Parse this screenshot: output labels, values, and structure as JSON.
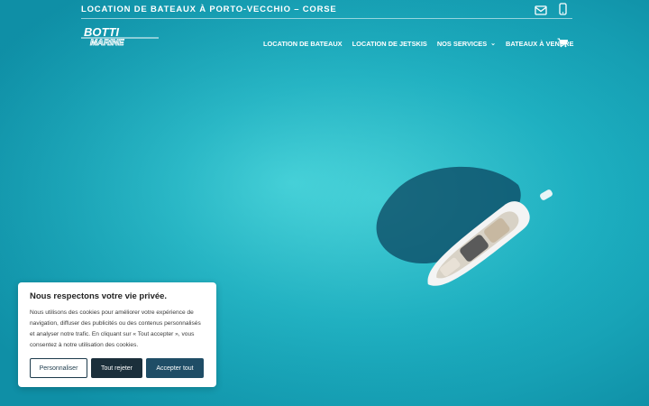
{
  "header": {
    "tagline": "LOCATION DE BATEAUX À PORTO-VECCHIO – CORSE",
    "icons": [
      "mail-icon",
      "phone-icon"
    ],
    "logo_text": "BOTTI MARINE"
  },
  "nav": {
    "items": [
      {
        "label": "LOCATION DE BATEAUX"
      },
      {
        "label": "LOCATION DE JETSKIS"
      },
      {
        "label": "NOS SERVICES"
      },
      {
        "label": "BATEAUX À VENDRE"
      }
    ],
    "cart_icon": "cart-icon"
  },
  "cookie_banner": {
    "title": "Nous respectons votre vie privée.",
    "text": "Nous utilisons des cookies pour améliorer votre expérience de navigation, diffuser des publicités ou des contenus personnalisés et analyser notre trafic. En cliquant sur « Tout accepter », vous consentez à notre utilisation des cookies.",
    "buttons": {
      "customize": "Personnaliser",
      "reject": "Tout rejeter",
      "accept": "Accepter tout"
    }
  },
  "colors": {
    "sea": "#1fb6c6",
    "dark_button": "#1b2f3b",
    "accent_button": "#1f4d66"
  }
}
